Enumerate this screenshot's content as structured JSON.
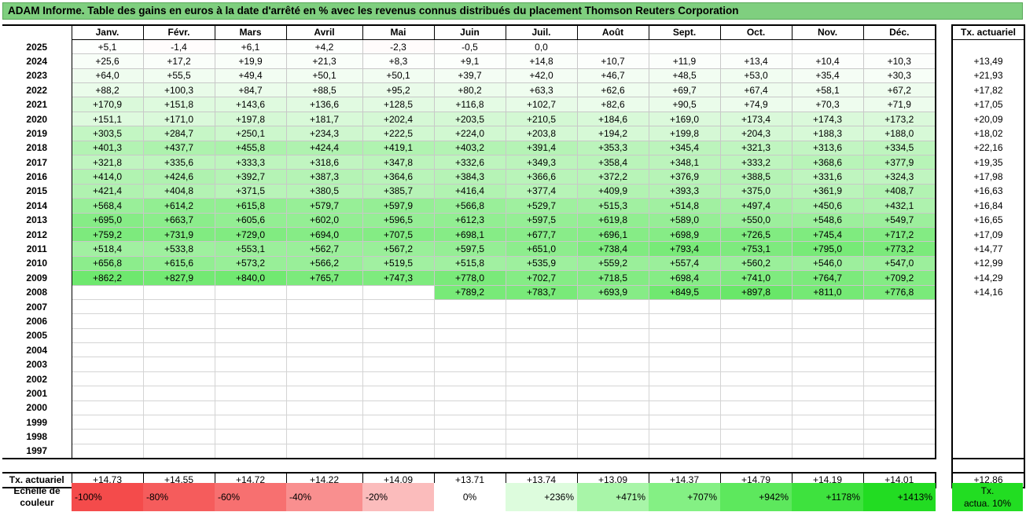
{
  "title": "ADAM Informe. Table des gains en euros à la date d'arrêté en % avec les revenus connus distribués du placement Thomson Reuters Corporation",
  "months": [
    "Janv.",
    "Févr.",
    "Mars",
    "Avril",
    "Mai",
    "Juin",
    "Juil.",
    "Août",
    "Sept.",
    "Oct.",
    "Nov.",
    "Déc."
  ],
  "rate_header": "Tx. actuariel",
  "rows": [
    {
      "year": "2025",
      "values": [
        "+5,1",
        "-1,4",
        "+6,1",
        "+4,2",
        "-2,3",
        "-0,5",
        "0,0",
        null,
        null,
        null,
        null,
        null
      ],
      "rate": ""
    },
    {
      "year": "2024",
      "values": [
        "+25,6",
        "+17,2",
        "+19,9",
        "+21,3",
        "+8,3",
        "+9,1",
        "+14,8",
        "+10,7",
        "+11,9",
        "+13,4",
        "+10,4",
        "+10,3"
      ],
      "rate": "+13,49"
    },
    {
      "year": "2023",
      "values": [
        "+64,0",
        "+55,5",
        "+49,4",
        "+50,1",
        "+50,1",
        "+39,7",
        "+42,0",
        "+46,7",
        "+48,5",
        "+53,0",
        "+35,4",
        "+30,3"
      ],
      "rate": "+21,93"
    },
    {
      "year": "2022",
      "values": [
        "+88,2",
        "+100,3",
        "+84,7",
        "+88,5",
        "+95,2",
        "+80,2",
        "+63,3",
        "+62,6",
        "+69,7",
        "+67,4",
        "+58,1",
        "+67,2"
      ],
      "rate": "+17,82"
    },
    {
      "year": "2021",
      "values": [
        "+170,9",
        "+151,8",
        "+143,6",
        "+136,6",
        "+128,5",
        "+116,8",
        "+102,7",
        "+82,6",
        "+90,5",
        "+74,9",
        "+70,3",
        "+71,9"
      ],
      "rate": "+17,05"
    },
    {
      "year": "2020",
      "values": [
        "+151,1",
        "+171,0",
        "+197,8",
        "+181,7",
        "+202,4",
        "+203,5",
        "+210,5",
        "+184,6",
        "+169,0",
        "+173,4",
        "+174,3",
        "+173,2"
      ],
      "rate": "+20,09"
    },
    {
      "year": "2019",
      "values": [
        "+303,5",
        "+284,7",
        "+250,1",
        "+234,3",
        "+222,5",
        "+224,0",
        "+203,8",
        "+194,2",
        "+199,8",
        "+204,3",
        "+188,3",
        "+188,0"
      ],
      "rate": "+18,02"
    },
    {
      "year": "2018",
      "values": [
        "+401,3",
        "+437,7",
        "+455,8",
        "+424,4",
        "+419,1",
        "+403,2",
        "+391,4",
        "+353,3",
        "+345,4",
        "+321,3",
        "+313,6",
        "+334,5"
      ],
      "rate": "+22,16"
    },
    {
      "year": "2017",
      "values": [
        "+321,8",
        "+335,6",
        "+333,3",
        "+318,6",
        "+347,8",
        "+332,6",
        "+349,3",
        "+358,4",
        "+348,1",
        "+333,2",
        "+368,6",
        "+377,9"
      ],
      "rate": "+19,35"
    },
    {
      "year": "2016",
      "values": [
        "+414,0",
        "+424,6",
        "+392,7",
        "+387,3",
        "+364,6",
        "+384,3",
        "+366,6",
        "+372,2",
        "+376,9",
        "+388,5",
        "+331,6",
        "+324,3"
      ],
      "rate": "+17,98"
    },
    {
      "year": "2015",
      "values": [
        "+421,4",
        "+404,8",
        "+371,5",
        "+380,5",
        "+385,7",
        "+416,4",
        "+377,4",
        "+409,9",
        "+393,3",
        "+375,0",
        "+361,9",
        "+408,7"
      ],
      "rate": "+16,63"
    },
    {
      "year": "2014",
      "values": [
        "+568,4",
        "+614,2",
        "+615,8",
        "+579,7",
        "+597,9",
        "+566,8",
        "+529,7",
        "+515,3",
        "+514,8",
        "+497,4",
        "+450,6",
        "+432,1"
      ],
      "rate": "+16,84"
    },
    {
      "year": "2013",
      "values": [
        "+695,0",
        "+663,7",
        "+605,6",
        "+602,0",
        "+596,5",
        "+612,3",
        "+597,5",
        "+619,8",
        "+589,0",
        "+550,0",
        "+548,6",
        "+549,7"
      ],
      "rate": "+16,65"
    },
    {
      "year": "2012",
      "values": [
        "+759,2",
        "+731,9",
        "+729,0",
        "+694,0",
        "+707,5",
        "+698,1",
        "+677,7",
        "+696,1",
        "+698,9",
        "+726,5",
        "+745,4",
        "+717,2"
      ],
      "rate": "+17,09"
    },
    {
      "year": "2011",
      "values": [
        "+518,4",
        "+533,8",
        "+553,1",
        "+562,7",
        "+567,2",
        "+597,5",
        "+651,0",
        "+738,4",
        "+793,4",
        "+753,1",
        "+795,0",
        "+773,2"
      ],
      "rate": "+14,77"
    },
    {
      "year": "2010",
      "values": [
        "+656,8",
        "+615,6",
        "+573,2",
        "+566,2",
        "+519,5",
        "+515,8",
        "+535,9",
        "+559,2",
        "+557,4",
        "+560,2",
        "+546,0",
        "+547,0"
      ],
      "rate": "+12,99"
    },
    {
      "year": "2009",
      "values": [
        "+862,2",
        "+827,9",
        "+840,0",
        "+765,7",
        "+747,3",
        "+778,0",
        "+702,7",
        "+718,5",
        "+698,4",
        "+741,0",
        "+764,7",
        "+709,2"
      ],
      "rate": "+14,29"
    },
    {
      "year": "2008",
      "values": [
        null,
        null,
        null,
        null,
        null,
        "+789,2",
        "+783,7",
        "+693,9",
        "+849,5",
        "+897,8",
        "+811,0",
        "+776,8"
      ],
      "rate": "+14,16"
    },
    {
      "year": "2007",
      "values": [
        null,
        null,
        null,
        null,
        null,
        null,
        null,
        null,
        null,
        null,
        null,
        null
      ],
      "rate": ""
    },
    {
      "year": "2006",
      "values": [
        null,
        null,
        null,
        null,
        null,
        null,
        null,
        null,
        null,
        null,
        null,
        null
      ],
      "rate": ""
    },
    {
      "year": "2005",
      "values": [
        null,
        null,
        null,
        null,
        null,
        null,
        null,
        null,
        null,
        null,
        null,
        null
      ],
      "rate": ""
    },
    {
      "year": "2004",
      "values": [
        null,
        null,
        null,
        null,
        null,
        null,
        null,
        null,
        null,
        null,
        null,
        null
      ],
      "rate": ""
    },
    {
      "year": "2003",
      "values": [
        null,
        null,
        null,
        null,
        null,
        null,
        null,
        null,
        null,
        null,
        null,
        null
      ],
      "rate": ""
    },
    {
      "year": "2002",
      "values": [
        null,
        null,
        null,
        null,
        null,
        null,
        null,
        null,
        null,
        null,
        null,
        null
      ],
      "rate": ""
    },
    {
      "year": "2001",
      "values": [
        null,
        null,
        null,
        null,
        null,
        null,
        null,
        null,
        null,
        null,
        null,
        null
      ],
      "rate": ""
    },
    {
      "year": "2000",
      "values": [
        null,
        null,
        null,
        null,
        null,
        null,
        null,
        null,
        null,
        null,
        null,
        null
      ],
      "rate": ""
    },
    {
      "year": "1999",
      "values": [
        null,
        null,
        null,
        null,
        null,
        null,
        null,
        null,
        null,
        null,
        null,
        null
      ],
      "rate": ""
    },
    {
      "year": "1998",
      "values": [
        null,
        null,
        null,
        null,
        null,
        null,
        null,
        null,
        null,
        null,
        null,
        null
      ],
      "rate": ""
    },
    {
      "year": "1997",
      "values": [
        null,
        null,
        null,
        null,
        null,
        null,
        null,
        null,
        null,
        null,
        null,
        null
      ],
      "rate": ""
    }
  ],
  "footer": {
    "label": "Tx. actuariel",
    "values": [
      "+14,73",
      "+14,55",
      "+14,72",
      "+14,22",
      "+14,09",
      "+13,71",
      "+13,74",
      "+13,09",
      "+14,37",
      "+14,79",
      "+14,19",
      "+14,01"
    ],
    "rate": "+12,86"
  },
  "legend": {
    "label_line1": "Echelle de",
    "label_line2": "couleur",
    "steps": [
      {
        "text": "-100%",
        "color": "#f44b4b",
        "align": "r"
      },
      {
        "text": "-80%",
        "color": "#f55c5c",
        "align": "r"
      },
      {
        "text": "-60%",
        "color": "#f77070",
        "align": "r"
      },
      {
        "text": "-40%",
        "color": "#f98f8f",
        "align": "r"
      },
      {
        "text": "-20%",
        "color": "#fbbcbc",
        "align": "r"
      },
      {
        "text": "0%",
        "color": "#ffffff",
        "align": "c"
      },
      {
        "text": "+236%",
        "color": "#ddfcdd",
        "align": "l"
      },
      {
        "text": "+471%",
        "color": "#a8f5a8",
        "align": "l"
      },
      {
        "text": "+707%",
        "color": "#84f084",
        "align": "l"
      },
      {
        "text": "+942%",
        "color": "#5de85d",
        "align": "l"
      },
      {
        "text": "+1178%",
        "color": "#3ee23e",
        "align": "l"
      },
      {
        "text": "+1413%",
        "color": "#22dc22",
        "align": "l"
      }
    ],
    "rate_line1": "Tx.",
    "rate_line2": "actua. 10%",
    "rate_color": "#22dd22"
  }
}
